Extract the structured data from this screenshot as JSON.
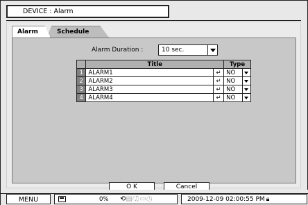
{
  "window": {
    "title": "DEVICE : Alarm"
  },
  "tabs": [
    {
      "label": "Alarm",
      "active": true
    },
    {
      "label": "Schedule",
      "active": false
    }
  ],
  "alarm_duration": {
    "label": "Alarm Duration :",
    "value": "10 sec."
  },
  "table": {
    "headers": {
      "title": "Title",
      "type": "Type"
    },
    "rows": [
      {
        "index": "1",
        "title": "ALARM1",
        "type": "NO"
      },
      {
        "index": "2",
        "title": "ALARM2",
        "type": "NO"
      },
      {
        "index": "3",
        "title": "ALARM3",
        "type": "NO"
      },
      {
        "index": "4",
        "title": "ALARM4",
        "type": "NO"
      }
    ],
    "enter_glyph": "↵"
  },
  "buttons": {
    "ok": "O K",
    "cancel": "Cancel"
  },
  "statusbar": {
    "menu": "MENU",
    "hdd_percent": "0%",
    "icons": [
      "refresh-icon",
      "record-icon",
      "network-icon",
      "audio-icon",
      "screen-icon",
      "timer-icon"
    ],
    "datetime": "2009-12-09 02:00:55 PM",
    "lock_icon": "lock-icon"
  },
  "colors": {
    "background": "#e8e8e8",
    "content": "#c8c8c8",
    "header_cell": "#b0b0b0",
    "index_cell": "#808080"
  }
}
